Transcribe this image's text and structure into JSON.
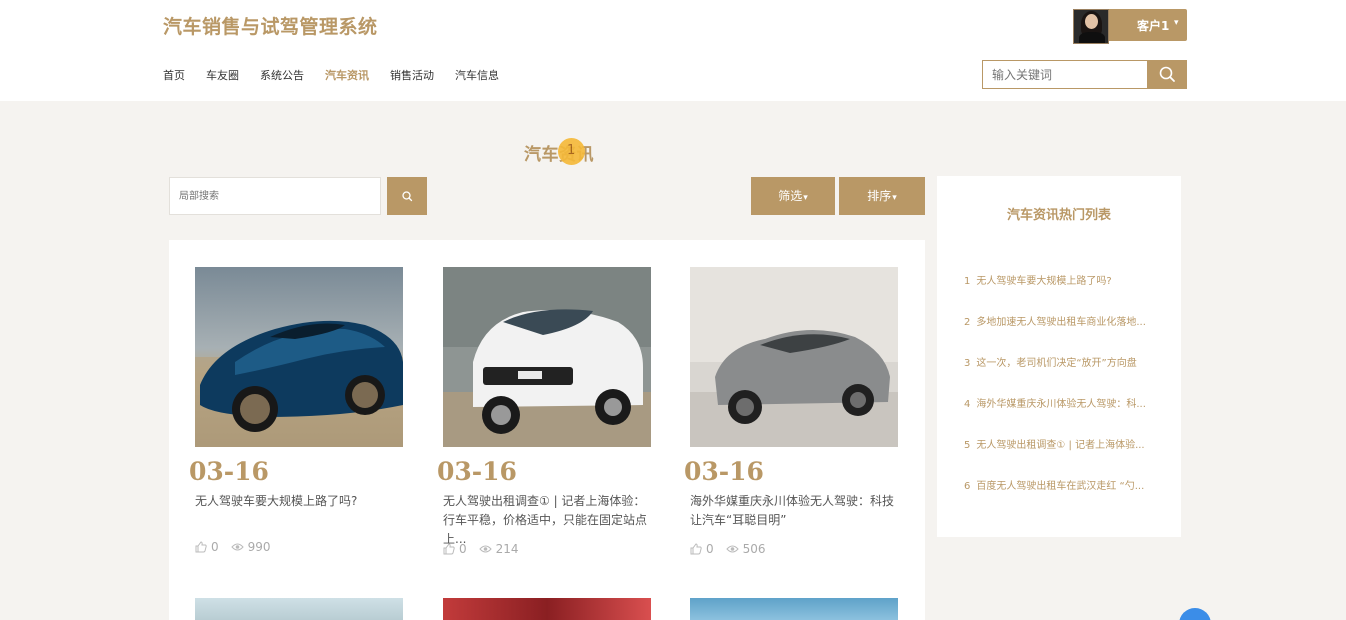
{
  "header": {
    "brand": "汽车销售与试驾管理系统",
    "user": {
      "name": "客户1",
      "caret": "▾"
    },
    "nav": [
      {
        "label": "首页",
        "active": false
      },
      {
        "label": "车友圈",
        "active": false
      },
      {
        "label": "系统公告",
        "active": false
      },
      {
        "label": "汽车资讯",
        "active": true
      },
      {
        "label": "销售活动",
        "active": false
      },
      {
        "label": "汽车信息",
        "active": false
      }
    ],
    "search": {
      "placeholder": "输入关键词"
    }
  },
  "page": {
    "title": "汽车资讯",
    "badge": "1",
    "local_search_placeholder": "局部搜索",
    "filter_label": "筛选",
    "sort_label": "排序",
    "caret": "▾"
  },
  "news": [
    {
      "date": "03-16",
      "title": "无人驾驶车要大规模上路了吗?",
      "likes": "0",
      "views": "990"
    },
    {
      "date": "03-16",
      "title": "无人驾驶出租调查① | 记者上海体验：行车平稳，价格适中，只能在固定站点上...",
      "likes": "0",
      "views": "214"
    },
    {
      "date": "03-16",
      "title": "海外华媒重庆永川体验无人驾驶：科技让汽车“耳聪目明”",
      "likes": "0",
      "views": "506"
    }
  ],
  "sidebar": {
    "title": "汽车资讯热门列表",
    "items": [
      {
        "idx": "1",
        "text": "无人驾驶车要大规模上路了吗?"
      },
      {
        "idx": "2",
        "text": "多地加速无人驾驶出租车商业化落地..."
      },
      {
        "idx": "3",
        "text": "这一次，老司机们决定“放开”方向盘"
      },
      {
        "idx": "4",
        "text": "海外华媒重庆永川体验无人驾驶：科..."
      },
      {
        "idx": "5",
        "text": "无人驾驶出租调查① | 记者上海体验..."
      },
      {
        "idx": "6",
        "text": "百度无人驾驶出租车在武汉走红 “勺..."
      }
    ]
  },
  "colors": {
    "accent": "#b99866",
    "background": "#f5f3f0",
    "card": "#ffffff"
  }
}
